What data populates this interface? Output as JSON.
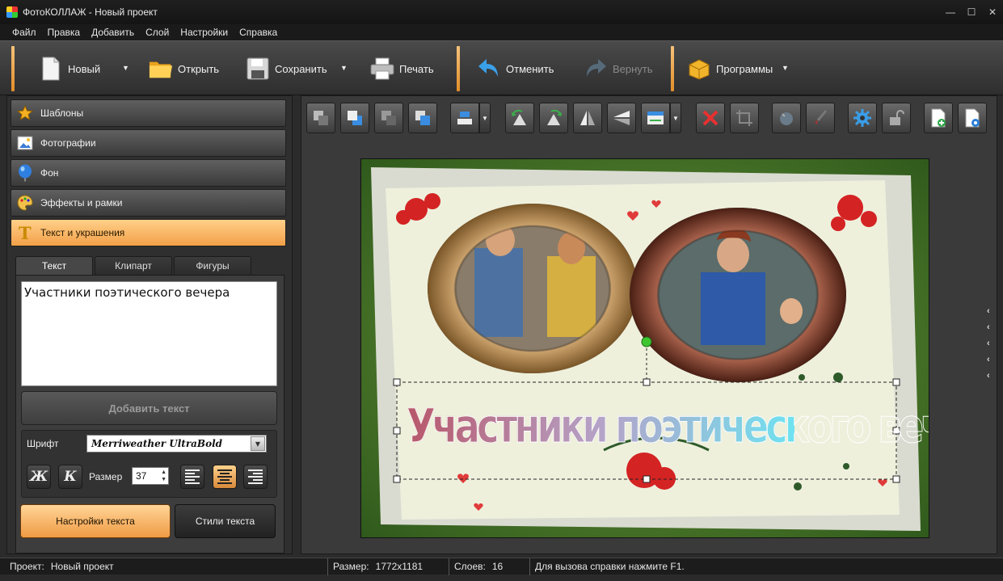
{
  "window": {
    "title": "ФотоКОЛЛАЖ - Новый проект",
    "minimize": "—",
    "maximize": "☐",
    "close": "✕"
  },
  "menu": [
    "Файл",
    "Правка",
    "Добавить",
    "Слой",
    "Настройки",
    "Справка"
  ],
  "toolbar": {
    "new_label": "Новый",
    "open_label": "Открыть",
    "save_label": "Сохранить",
    "print_label": "Печать",
    "undo_label": "Отменить",
    "redo_label": "Вернуть",
    "programs_label": "Программы",
    "caret": "▼"
  },
  "sidebar": {
    "sections": [
      {
        "label": "Шаблоны",
        "icon": "star-icon"
      },
      {
        "label": "Фотографии",
        "icon": "photo-icon"
      },
      {
        "label": "Фон",
        "icon": "balloon-icon"
      },
      {
        "label": "Эффекты и рамки",
        "icon": "palette-icon"
      },
      {
        "label": "Текст и украшения",
        "icon": "text-t-icon"
      }
    ],
    "active_section": 4,
    "tabs": [
      "Текст",
      "Клипарт",
      "Фигуры"
    ],
    "active_tab": 0
  },
  "text_panel": {
    "text_value": "Участники поэтического вечера",
    "add_button": "Добавить текст",
    "font_label": "Шрифт",
    "font_value": "Merriweather UltraBold",
    "bold_label": "Ж",
    "italic_label": "К",
    "size_label": "Размер",
    "size_value": "37",
    "alignment": "center",
    "settings_button": "Настройки текста",
    "styles_button": "Стили текста"
  },
  "canvas": {
    "caption": "Участники поэтического вечера",
    "colors": {
      "grass": "#4d7a2e",
      "paper": "#eef0dc",
      "flower": "#d42323"
    }
  },
  "side_arrows": "‹",
  "status": {
    "project_key": "Проект:",
    "project_value": "Новый проект",
    "size_key": "Размер:",
    "size_value": "1772x1181",
    "layers_key": "Слоев:",
    "layers_value": "16",
    "hint": "Для вызова справки нажмите F1."
  },
  "colors": {
    "accent": "#f2a048",
    "separator": "#e8953a",
    "background": "#2b2b2b"
  }
}
